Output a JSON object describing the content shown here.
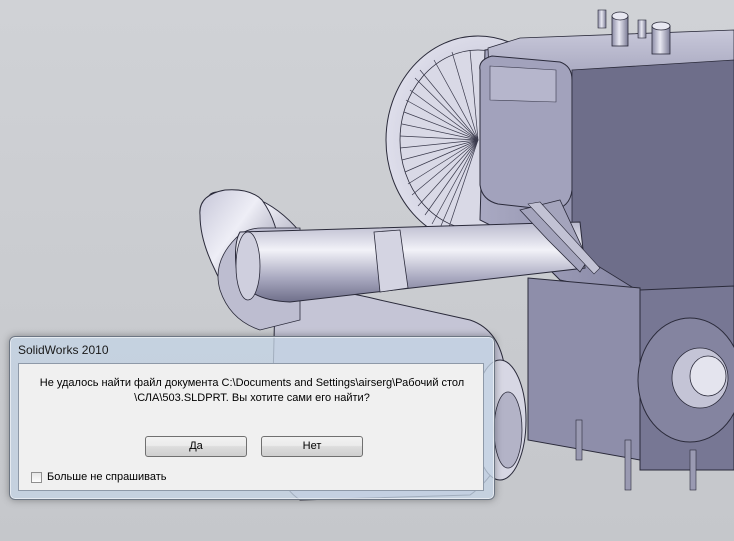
{
  "dialog": {
    "title": "SolidWorks 2010",
    "message_line1": "Не удалось найти файл документа C:\\Documents and Settings\\airserg\\Рабочий стол",
    "message_line2": "\\СЛА\\503.SLDPRT. Вы хотите сами его найти?",
    "yes_label": "Да",
    "no_label": "Нет",
    "checkbox_label": "Больше не спрашивать",
    "checkbox_checked": false
  },
  "colors": {
    "viewport_background": "#cbcdd1",
    "model_shade": "#9d9db8",
    "model_highlight": "#e8e8f2",
    "model_shadow": "#5a5a73"
  }
}
